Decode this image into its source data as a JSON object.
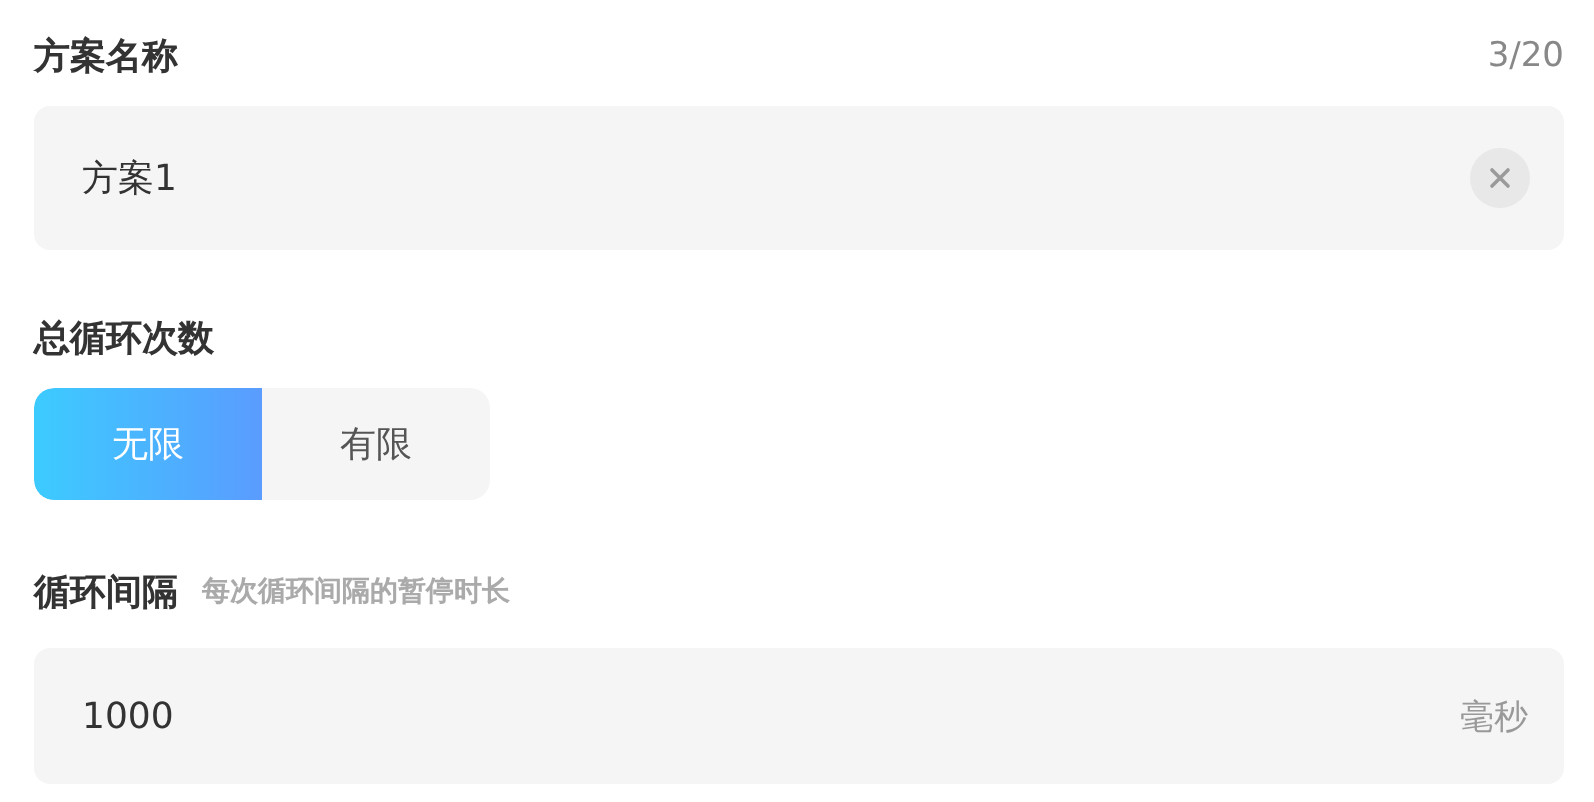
{
  "name_field": {
    "label": "方案名称",
    "counter": "3/20",
    "value": "方案1"
  },
  "loop_count": {
    "label": "总循环次数",
    "options": [
      {
        "label": "无限",
        "selected": true
      },
      {
        "label": "有限",
        "selected": false
      }
    ]
  },
  "loop_interval": {
    "label": "循环间隔",
    "hint": "每次循环间隔的暂停时长",
    "value": "1000",
    "unit": "毫秒"
  }
}
